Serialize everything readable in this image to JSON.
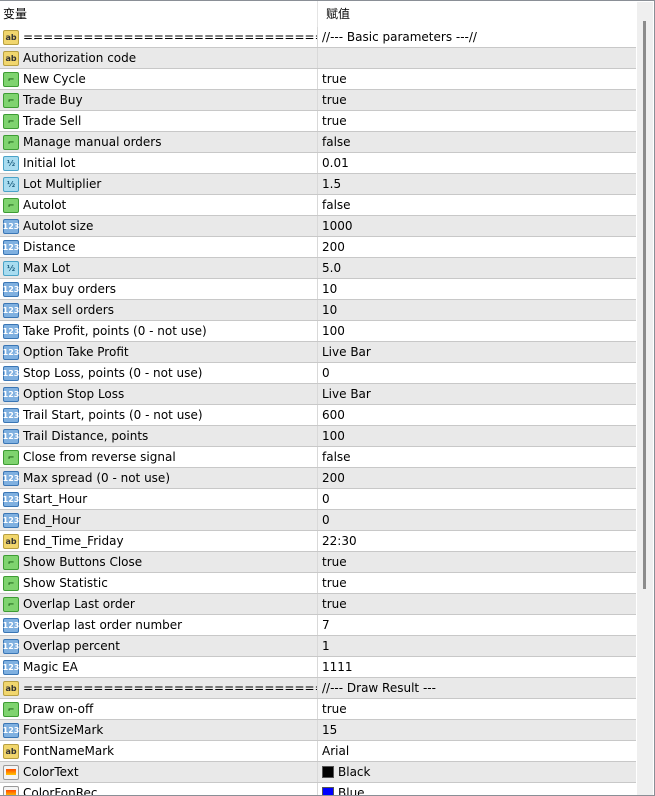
{
  "header": {
    "col_variable": "变量",
    "col_value": "赋值"
  },
  "rows": [
    {
      "type": "ab",
      "name": "==============================...",
      "value": "//--- Basic parameters ---//"
    },
    {
      "type": "ab",
      "name": "Authorization code",
      "value": ""
    },
    {
      "type": "bool",
      "name": "New Cycle",
      "value": "true"
    },
    {
      "type": "bool",
      "name": "Trade Buy",
      "value": "true"
    },
    {
      "type": "bool",
      "name": "Trade Sell",
      "value": "true"
    },
    {
      "type": "bool",
      "name": "Manage manual orders",
      "value": "false"
    },
    {
      "type": "dbl",
      "name": "Initial lot",
      "value": "0.01"
    },
    {
      "type": "dbl",
      "name": "Lot Multiplier",
      "value": "1.5"
    },
    {
      "type": "bool",
      "name": "Autolot",
      "value": "false"
    },
    {
      "type": "int",
      "name": "Autolot size",
      "value": "1000"
    },
    {
      "type": "int",
      "name": "Distance",
      "value": "200"
    },
    {
      "type": "dbl",
      "name": "Max Lot",
      "value": "5.0"
    },
    {
      "type": "int",
      "name": "Max buy orders",
      "value": "10"
    },
    {
      "type": "int",
      "name": "Max sell orders",
      "value": "10"
    },
    {
      "type": "int",
      "name": "Take Profit, points (0 - not use)",
      "value": "100"
    },
    {
      "type": "int",
      "name": "Option Take Profit",
      "value": "Live Bar"
    },
    {
      "type": "int",
      "name": "Stop Loss, points (0 - not use)",
      "value": "0"
    },
    {
      "type": "int",
      "name": "Option Stop Loss",
      "value": "Live Bar"
    },
    {
      "type": "int",
      "name": "Trail Start, points (0 - not use)",
      "value": "600"
    },
    {
      "type": "int",
      "name": "Trail Distance, points",
      "value": "100"
    },
    {
      "type": "bool",
      "name": "Close from reverse signal",
      "value": "false"
    },
    {
      "type": "int",
      "name": "Max spread (0 - not use)",
      "value": "200"
    },
    {
      "type": "int",
      "name": "Start_Hour",
      "value": "0"
    },
    {
      "type": "int",
      "name": "End_Hour",
      "value": "0"
    },
    {
      "type": "ab",
      "name": "End_Time_Friday",
      "value": "22:30"
    },
    {
      "type": "bool",
      "name": "Show Buttons Close",
      "value": "true"
    },
    {
      "type": "bool",
      "name": "Show Statistic",
      "value": "true"
    },
    {
      "type": "bool",
      "name": "Overlap Last order",
      "value": "true"
    },
    {
      "type": "int",
      "name": "Overlap last order number",
      "value": "7"
    },
    {
      "type": "int",
      "name": "Overlap percent",
      "value": "1"
    },
    {
      "type": "int",
      "name": "Magic EA",
      "value": "1111"
    },
    {
      "type": "ab",
      "name": "==============================...",
      "value": "//--- Draw Result ---"
    },
    {
      "type": "bool",
      "name": "Draw on-off",
      "value": "true"
    },
    {
      "type": "int",
      "name": "FontSizeMark",
      "value": "15"
    },
    {
      "type": "ab",
      "name": "FontNameMark",
      "value": "Arial"
    },
    {
      "type": "col",
      "name": "ColorText",
      "value": "Black",
      "color": "#000000"
    },
    {
      "type": "col",
      "name": "ColorFonRec",
      "value": "Blue",
      "color": "#0000ff"
    }
  ],
  "icons": {
    "ab": "string-icon",
    "bool": "bool-icon",
    "dbl": "double-icon",
    "int": "integer-icon",
    "col": "color-icon"
  },
  "icon_glyphs": {
    "ab": "ab",
    "bool": "⌐",
    "dbl": "½",
    "int": "123",
    "col": ""
  }
}
